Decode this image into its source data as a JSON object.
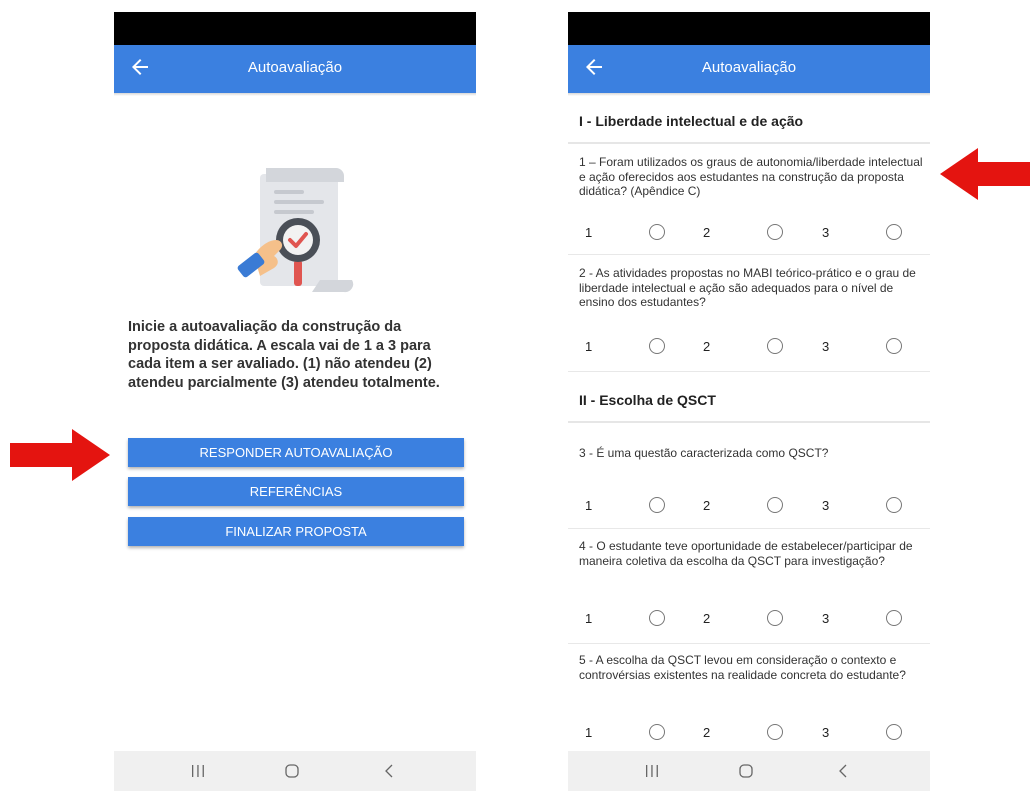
{
  "colors": {
    "app_bar": "#3b80e0",
    "arrow": "#e41410",
    "button": "#3b80e0"
  },
  "left_screen": {
    "title": "Autoavaliação",
    "intro": "Inicie a autoavaliação da construção da proposta didática. A escala vai de 1 a 3 para cada item a ser avaliado. (1) não atendeu (2) atendeu parcialmente (3) atendeu totalmente.",
    "buttons": {
      "respond": "RESPONDER AUTOAVALIAÇÃO",
      "references": "REFERÊNCIAS",
      "finish": "FINALIZAR PROPOSTA"
    },
    "illustration_icon": "document-magnifier-check-icon"
  },
  "right_screen": {
    "title": "Autoavaliação",
    "sections": [
      {
        "title": "I - Liberdade intelectual e de ação",
        "questions": [
          {
            "text": "1 – Foram utilizados os graus de autonomia/liberdade intelectual e ação oferecidos aos estudantes na construção da proposta didática? (Apêndice C)",
            "options": [
              "1",
              "2",
              "3"
            ]
          },
          {
            "text": "2 - As atividades propostas no MABI teórico-prático e o grau de liberdade intelectual e ação são adequados para o nível de ensino dos estudantes?",
            "options": [
              "1",
              "2",
              "3"
            ]
          }
        ]
      },
      {
        "title": "II - Escolha de QSCT",
        "questions": [
          {
            "text": "3 - É uma questão caracterizada como QSCT?",
            "options": [
              "1",
              "2",
              "3"
            ]
          },
          {
            "text": "4 - O estudante teve oportunidade de estabelecer/participar de maneira coletiva da escolha da QSCT para investigação?",
            "options": [
              "1",
              "2",
              "3"
            ]
          },
          {
            "text": "5 - A escolha da QSCT levou em consideração o contexto e controvérsias existentes na realidade concreta do estudante?",
            "options": [
              "1",
              "2",
              "3"
            ]
          }
        ]
      }
    ]
  },
  "nav_icons": [
    "recents-icon",
    "home-icon",
    "back-icon"
  ]
}
